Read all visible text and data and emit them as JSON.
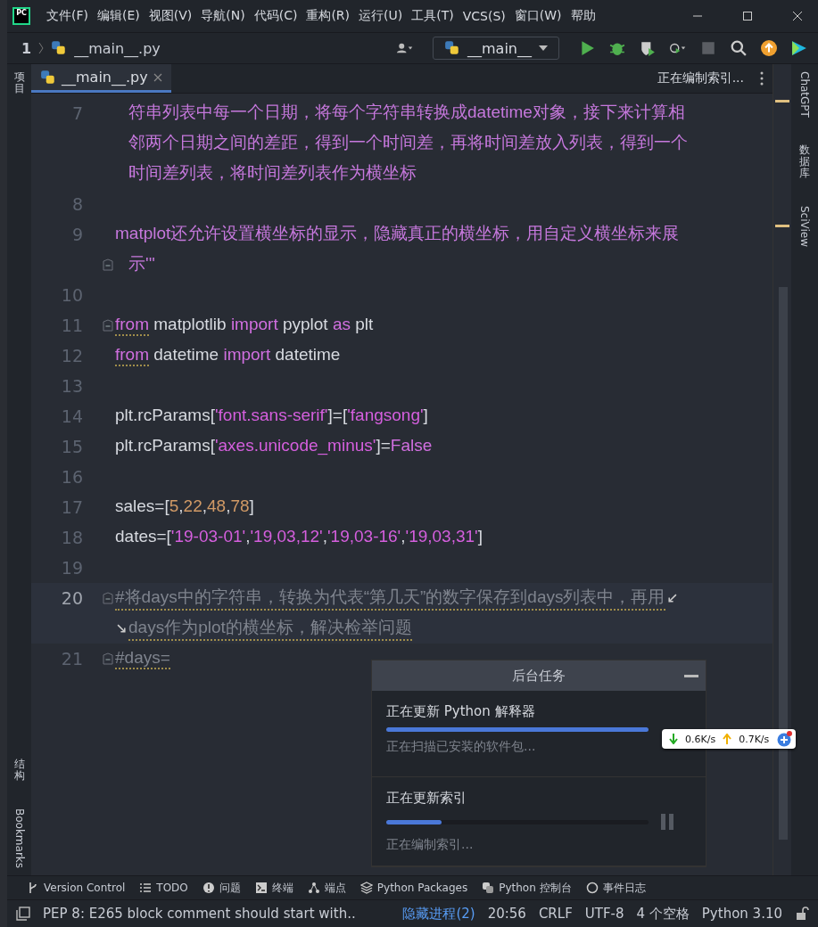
{
  "logo": "PC",
  "menu": [
    "文件(F)",
    "编辑(E)",
    "视图(V)",
    "导航(N)",
    "代码(C)",
    "重构(R)",
    "运行(U)",
    "工具(T)",
    "VCS(S)",
    "窗口(W)",
    "帮助"
  ],
  "breadcrumb": {
    "project": "1",
    "file": "__main__.py"
  },
  "run_config": "__main__",
  "left_tools": [
    "项目",
    "结构",
    "Bookmarks"
  ],
  "right_tools": [
    "ChatGPT",
    "数据库",
    "SciView"
  ],
  "tabs": [
    {
      "label": "__main__.py",
      "selected": true
    }
  ],
  "tooltip": "正在编制索引...",
  "code": {
    "lines": [
      {
        "number": "7",
        "current": false,
        "fold": false,
        "rows": [
          [
            {
              "kind": "doc",
              "text": "符串列表中每一个日期，将每个字符串转换成datetime对象，接下来计算相",
              "warn": false
            }
          ],
          [
            {
              "kind": "doc",
              "text": "邻两个日期之间的差距，得到一个时间差，再将时间差放入列表，得到一个",
              "warn": false
            }
          ],
          [
            {
              "kind": "doc",
              "text": "时间差列表，将时间差列表作为横坐标",
              "warn": false
            }
          ]
        ]
      },
      {
        "number": "8",
        "current": false,
        "fold": false,
        "rows": [
          []
        ]
      },
      {
        "number": "9",
        "current": false,
        "fold": true,
        "rows": [
          [
            {
              "kind": "doc",
              "text": "matplot还允许设置横坐标的显示，隐藏真正的横坐标，用自定义横坐标来展",
              "warn": false
            }
          ],
          [
            {
              "kind": "doc",
              "text": "示'''",
              "warn": false
            }
          ]
        ]
      },
      {
        "number": "10",
        "current": false,
        "fold": false,
        "rows": [
          []
        ]
      },
      {
        "number": "11",
        "current": false,
        "fold": true,
        "rows": [
          [
            {
              "kind": "kw",
              "text": "from",
              "warn": true
            },
            {
              "kind": "plain",
              "text": " matplotlib ",
              "warn": false
            },
            {
              "kind": "kw",
              "text": "import",
              "warn": false
            },
            {
              "kind": "plain",
              "text": " pyplot ",
              "warn": false
            },
            {
              "kind": "kw",
              "text": "as",
              "warn": false
            },
            {
              "kind": "plain",
              "text": " plt",
              "warn": false
            }
          ]
        ]
      },
      {
        "number": "12",
        "current": false,
        "fold": false,
        "rows": [
          [
            {
              "kind": "kw",
              "text": "from",
              "warn": true
            },
            {
              "kind": "plain",
              "text": " datetime ",
              "warn": false
            },
            {
              "kind": "kw",
              "text": "import",
              "warn": false
            },
            {
              "kind": "plain",
              "text": " datetime",
              "warn": false
            }
          ]
        ]
      },
      {
        "number": "13",
        "current": false,
        "fold": false,
        "rows": [
          []
        ]
      },
      {
        "number": "14",
        "current": false,
        "fold": false,
        "rows": [
          [
            {
              "kind": "plain",
              "text": "plt.rcParams[",
              "warn": false
            },
            {
              "kind": "str",
              "text": "'font.sans-serif'",
              "warn": false
            },
            {
              "kind": "plain",
              "text": "]=[",
              "warn": false
            },
            {
              "kind": "str",
              "text": "'fangsong'",
              "warn": false
            },
            {
              "kind": "plain",
              "text": "]",
              "warn": false
            }
          ]
        ]
      },
      {
        "number": "15",
        "current": false,
        "fold": false,
        "rows": [
          [
            {
              "kind": "plain",
              "text": "plt.rcParams[",
              "warn": false
            },
            {
              "kind": "str",
              "text": "'axes.unicode_minus'",
              "warn": false
            },
            {
              "kind": "plain",
              "text": "]=",
              "warn": false
            },
            {
              "kind": "kw",
              "text": "False",
              "warn": false
            }
          ]
        ]
      },
      {
        "number": "16",
        "current": false,
        "fold": false,
        "rows": [
          []
        ]
      },
      {
        "number": "17",
        "current": false,
        "fold": false,
        "rows": [
          [
            {
              "kind": "plain",
              "text": "sales=[",
              "warn": false
            },
            {
              "kind": "num",
              "text": "5",
              "warn": false
            },
            {
              "kind": "plain",
              "text": ",",
              "warn": false
            },
            {
              "kind": "num",
              "text": "22",
              "warn": false
            },
            {
              "kind": "plain",
              "text": ",",
              "warn": false
            },
            {
              "kind": "num",
              "text": "48",
              "warn": false
            },
            {
              "kind": "plain",
              "text": ",",
              "warn": false
            },
            {
              "kind": "num",
              "text": "78",
              "warn": false
            },
            {
              "kind": "plain",
              "text": "]",
              "warn": false
            }
          ]
        ]
      },
      {
        "number": "18",
        "current": false,
        "fold": false,
        "rows": [
          [
            {
              "kind": "plain",
              "text": "dates=[",
              "warn": false
            },
            {
              "kind": "str",
              "text": "'19-03-01'",
              "warn": false
            },
            {
              "kind": "plain",
              "text": ",",
              "warn": false
            },
            {
              "kind": "str",
              "text": "'19,03,12'",
              "warn": false
            },
            {
              "kind": "plain",
              "text": ",",
              "warn": false
            },
            {
              "kind": "str",
              "text": "'19,03-16'",
              "warn": false
            },
            {
              "kind": "plain",
              "text": ",",
              "warn": false
            },
            {
              "kind": "str",
              "text": "'19,03,31'",
              "warn": false
            },
            {
              "kind": "plain",
              "text": "]",
              "warn": false
            }
          ]
        ]
      },
      {
        "number": "19",
        "current": false,
        "fold": false,
        "rows": [
          []
        ]
      },
      {
        "number": "20",
        "current": true,
        "fold": true,
        "rows": [
          [
            {
              "kind": "comment",
              "text": "#将days中的字符串，转换为代表“第几天”的数字保存到days列表中，再用",
              "warn": true
            }
          ],
          [
            {
              "kind": "comment",
              "text": "days作为plot的横坐标，解决检举问题",
              "warn": true
            }
          ]
        ]
      },
      {
        "number": "21",
        "current": false,
        "fold": true,
        "rows": [
          [
            {
              "kind": "comment",
              "text": "#days=",
              "warn": true
            }
          ]
        ]
      }
    ]
  },
  "background_tasks": {
    "title": "后台任务",
    "tasks": [
      {
        "name": "正在更新 Python 解释器",
        "level": 1,
        "detail": "正在扫描已安装的软件包...",
        "paused": false
      },
      {
        "name": "正在更新索引",
        "level": 0.21,
        "detail": "正在编制索引...",
        "paused": true
      }
    ]
  },
  "net_speed": {
    "down": "0.6K/s",
    "up": "0.7K/s"
  },
  "tool_bar": [
    "Version Control",
    "TODO",
    "问题",
    "终端",
    "端点",
    "Python Packages",
    "Python 控制台",
    "事件日志"
  ],
  "status_bar": {
    "message": "PEP 8: E265 block comment should start with..",
    "processes": "隐藏进程(2)",
    "items": [
      "20:56",
      "CRLF",
      "UTF-8",
      "4 个空格",
      "Python 3.10"
    ]
  }
}
